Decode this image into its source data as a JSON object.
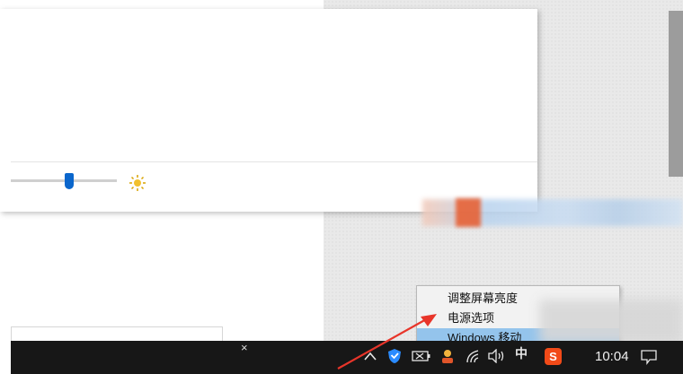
{
  "context_menu": {
    "items": [
      {
        "label": "调整屏幕亮度"
      },
      {
        "label": "电源选项"
      },
      {
        "label": "Windows 移动"
      }
    ]
  },
  "taskbar": {
    "clock": "10:04",
    "close_glyph": "×",
    "tray_icons": [
      "chevron-up-icon",
      "shield-icon",
      "battery-icon",
      "user-icon",
      "wifi-icon",
      "volume-icon",
      "ime-icon",
      "sogou-icon"
    ],
    "ime_label": "中",
    "sogou_label": "S"
  },
  "brightness": {
    "level": 0.55
  },
  "colors": {
    "accent": "#0a66cc",
    "menu_highlight": "#94c4ec",
    "taskbar": "#171717",
    "arrow": "#e8352a"
  }
}
